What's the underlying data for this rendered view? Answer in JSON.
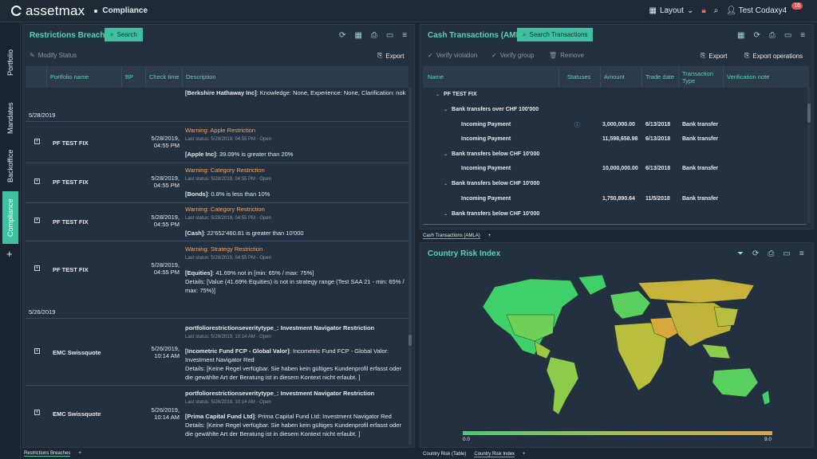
{
  "app": {
    "logo": "assetmax",
    "module": "Compliance",
    "layout_label": "Layout",
    "user": "Test Codaxy4",
    "notifications": "16"
  },
  "sidenav": {
    "tabs": [
      "Portfolio",
      "Mandates",
      "Backoffice",
      "Compliance"
    ],
    "active": "Compliance",
    "add": "+"
  },
  "restrictions": {
    "title": "Restrictions Breaches",
    "search_label": "Search",
    "modify_status": "Modify Status",
    "export": "Export",
    "columns": [
      "Portfolio name",
      "BP",
      "Check time",
      "Description"
    ],
    "top_fragment_bold": "[Berkshire Hathaway Inc]",
    "top_fragment_text": ": Knowledge: None, Experience: None, Clarification: nok",
    "groups": [
      {
        "date": "5/28/2019",
        "rows": [
          {
            "portfolio": "PF TEST FIX",
            "time1": "5/28/2019,",
            "time2": "04:55 PM",
            "warning": "Warning: Apple Restriction",
            "status": "Last status: 5/28/2019, 04:55 PM - Open",
            "desc_bold": "[Apple Inc]",
            "desc": ": 39.09% is greater than 20%"
          },
          {
            "portfolio": "PF TEST FIX",
            "time1": "5/28/2019,",
            "time2": "04:55 PM",
            "warning": "Warning: Category Restriction",
            "status": "Last status: 5/28/2019, 04:55 PM - Open",
            "desc_bold": "[Bonds]",
            "desc": ": 0.8% is less than 10%"
          },
          {
            "portfolio": "PF TEST FIX",
            "time1": "5/28/2019,",
            "time2": "04:55 PM",
            "warning": "Warning: Category Restriction",
            "status": "Last status: 5/28/2019, 04:55 PM - Open",
            "desc_bold": "[Cash]",
            "desc": ": 22'652'460.81 is greater than 10'000"
          },
          {
            "portfolio": "PF TEST FIX",
            "time1": "5/28/2019,",
            "time2": "04:55 PM",
            "warning": "Warning: Strategy Restriction",
            "status": "Last status: 5/28/2019, 04:55 PM - Open",
            "desc_bold": "[Equities]",
            "desc": ": 41.69% not in [min: 65% / max: 75%]",
            "extra1": "Details: [Value (41.69% Equities) is not in strategy range (Test SAA 21 - min: 65% /",
            "extra2": "max: 75%)]"
          }
        ]
      },
      {
        "date": "5/26/2019",
        "rows": [
          {
            "portfolio": "EMC Swissquote",
            "time1": "5/26/2019,",
            "time2": "10:14 AM",
            "warning": "portfoliorestrictionseveritytype_: Investment Navigator Restriction",
            "status": "Last status: 5/26/2019, 10:14 AM - Open",
            "desc_bold": "[Incometric Fund FCP - Global Valor]",
            "desc": ": Incometric Fund FCP - Global Valor:",
            "extra0": "Investment Navigator Red",
            "extra1": "Details: [Keine Regel verfügbar. Sie haben kein gültiges Kundenprofil erfasst oder",
            "extra2": "die gewählte Art der Beratung ist in diesem Kontext nicht erlaubt. ]"
          },
          {
            "portfolio": "EMC Swissquote",
            "time1": "5/26/2019,",
            "time2": "10:14 AM",
            "warning": "portfoliorestrictionseveritytype_: Investment Navigator Restriction",
            "status": "Last status: 5/26/2019, 10:14 AM - Open",
            "desc_bold": "[Prima Capital Fund Ltd]",
            "desc": ": Prima Capital Fund Ltd: Investment Navigator Red",
            "extra1": "Details: [Keine Regel verfügbar. Sie haben kein gültiges Kundenprofil erfasst oder",
            "extra2": "die gewählte Art der Beratung ist in diesem Kontext nicht erlaubt. ]"
          }
        ]
      }
    ],
    "bottom_tab": "Restrictions Breaches",
    "bottom_add": "+"
  },
  "cash": {
    "title": "Cash Transactions (AMLA)",
    "search_label": "Search Transactions",
    "tools": [
      "Verify violation",
      "Verify group",
      "Remove"
    ],
    "export": "Export",
    "export_ops": "Export operations",
    "columns": [
      "Name",
      "Statuses",
      "Amount",
      "Trade date",
      "Transaction Type",
      "Verification note"
    ],
    "root": "PF TEST FIX",
    "groups": [
      {
        "label": "Bank transfers over CHF 100'000",
        "rows": [
          {
            "name": "Incoming Payment",
            "info": true,
            "amount": "3,000,000.00",
            "date": "6/13/2018",
            "type": "Bank transfer"
          },
          {
            "name": "Incoming Payment",
            "info": false,
            "amount": "11,598,658.98",
            "date": "6/13/2018",
            "type": "Bank transfer"
          }
        ]
      },
      {
        "label": "Bank transfers below CHF 10'000",
        "rows": [
          {
            "name": "Incoming Payment",
            "info": false,
            "amount": "10,000,000.00",
            "date": "6/13/2018",
            "type": "Bank transfer"
          }
        ]
      },
      {
        "label": "Bank transfers below CHF 10'000",
        "rows": [
          {
            "name": "Incoming Payment",
            "info": false,
            "amount": "1,750,890.64",
            "date": "11/5/2018",
            "type": "Bank transfer"
          }
        ]
      },
      {
        "label": "Bank transfers below CHF 10'000",
        "rows": []
      }
    ],
    "bottom_tab": "Cash Transactions (AMLA)",
    "bottom_add": "+"
  },
  "risk": {
    "title": "Country Risk Index",
    "legend_min": "0.0",
    "legend_max": "9.0",
    "tabs": [
      "Country Risk (Table)",
      "Country Risk Index"
    ],
    "bottom_add": "+",
    "colors": {
      "low": "#3fd06a",
      "mid": "#a8c23e",
      "high": "#e3a33b"
    }
  }
}
